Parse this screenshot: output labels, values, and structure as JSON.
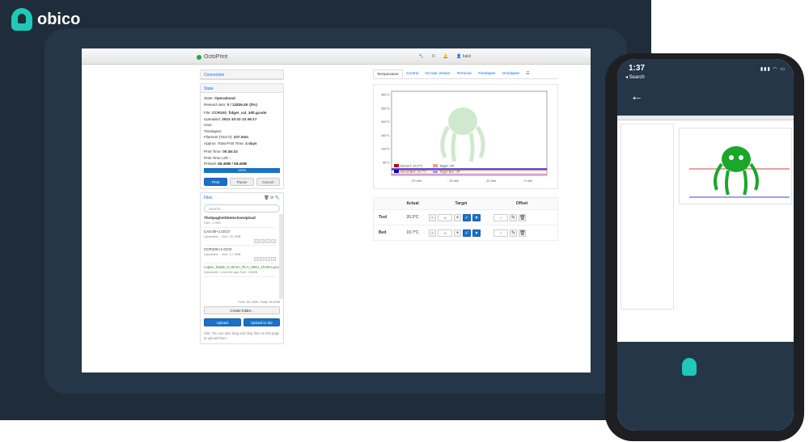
{
  "brand": {
    "name": "obico"
  },
  "app": {
    "title": "OctoPrint",
    "user": "bakli"
  },
  "connection": {
    "label": "Connection"
  },
  "state": {
    "header": "State",
    "state_label": "State:",
    "state_value": "Operational",
    "resend_label": "Resend ratio:",
    "resend_value": "0 / 12836.4K (0%)",
    "file_label": "File:",
    "file_value": "CCR10S_fidget_cat_30ll.gcode",
    "uploaded_label": "Uploaded:",
    "uploaded_value": "2021-10-22 12:46:17",
    "user_label": "User:",
    "timelapse_label": "Timelapse:",
    "filament_label": "Filament (Tool 0):",
    "filament_value": "227.04m",
    "approx_label": "Approx. Total Print Time:",
    "approx_value": "4 days",
    "print_time_label": "Print Time:",
    "print_time_value": "00:46:23",
    "time_left_label": "Print Time Left:",
    "time_left_value": "-",
    "printed_label": "Printed:",
    "printed_value": "58.4MB / 58.4MB",
    "progress": "100%"
  },
  "actions": {
    "print": "Print",
    "pause": "Pause",
    "cancel": "Cancel"
  },
  "files": {
    "header": "Files",
    "search_placeholder": "Search...",
    "items": [
      {
        "name": "TheSpaghettiDetectiveUpload",
        "meta": "Size: 1.9KB",
        "green": false
      },
      {
        "name": "CA3-30+1.GCO",
        "meta": "Uploaded: - Size: 20.2MB",
        "green": false
      },
      {
        "name": "CCR10S+1.GCO",
        "meta": "Uploaded: - Size: 17.3MB",
        "green": false
      },
      {
        "name": "copter_blade_0.15mm_PLA_MINI_1h20m.gcode",
        "meta": "Uploaded: 3 months ago Size: 3.8MB",
        "green": true
      }
    ],
    "free": "Free: 92.2GB / Total: 99.3GB",
    "create_folder": "Create folder...",
    "upload": "Upload",
    "upload_sd": "Upload to SD",
    "hint": "Hint: You can also drag and drop files on this page to upload them."
  },
  "tabs": [
    "Temperature",
    "Control",
    "GCode Viewer",
    "Terminal",
    "Timelapse",
    "Octolapse"
  ],
  "chart_data": {
    "type": "line",
    "title": "",
    "xlabel": "",
    "ylabel": "",
    "y_ticks": [
      "300°C",
      "250°C",
      "200°C",
      "150°C",
      "100°C",
      "50°C"
    ],
    "x_ticks": [
      "- 20 min",
      "- 15 min",
      "- 10 min",
      "- 5 min"
    ],
    "ylim": [
      0,
      300
    ],
    "series": [
      {
        "name": "Actual T: 20.2°C",
        "color": "#cc0000",
        "values": [
          20,
          20,
          20,
          20
        ]
      },
      {
        "name": "Target: Off",
        "color": "#ff9999",
        "values": [
          0,
          0,
          0,
          0
        ]
      },
      {
        "name": "Actual Bed: 19.7°C",
        "color": "#0000cc",
        "values": [
          20,
          20,
          20,
          20
        ]
      },
      {
        "name": "Target Bed: Off",
        "color": "#9999ff",
        "values": [
          0,
          0,
          0,
          0
        ]
      }
    ]
  },
  "temps": {
    "col_actual": "Actual",
    "col_target": "Target",
    "col_offset": "Offset",
    "rows": [
      {
        "label": "Tool",
        "actual": "20.3°C",
        "target": "off",
        "offset": "0"
      },
      {
        "label": "Bed",
        "actual": "19.7°C",
        "target": "off",
        "offset": "0"
      }
    ]
  },
  "phone": {
    "time": "1:37",
    "back_search": "◂ Search",
    "back_arrow": "←"
  },
  "colors": {
    "frame": "#1f2c3a",
    "accent": "#1ec9b7",
    "primary": "#1b71c8"
  }
}
